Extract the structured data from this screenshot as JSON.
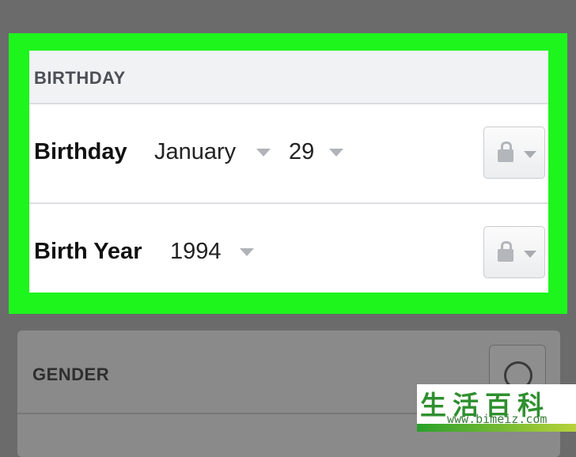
{
  "birthday_section": {
    "title": "BIRTHDAY",
    "birthday_row": {
      "label": "Birthday",
      "month": "January",
      "day": "29"
    },
    "birth_year_row": {
      "label": "Birth Year",
      "year": "1994"
    }
  },
  "gender_section": {
    "title": "GENDER"
  },
  "watermark": {
    "chinese": "生活百科",
    "url": "www.bimeiz.com"
  },
  "colors": {
    "highlight": "#1df51d",
    "overlay": "#6b6b6b",
    "header_bg": "#f1f2f4"
  },
  "icons": {
    "privacy": "lock-icon",
    "dropdown": "caret-down-icon",
    "gender": "radio-circle-icon"
  }
}
